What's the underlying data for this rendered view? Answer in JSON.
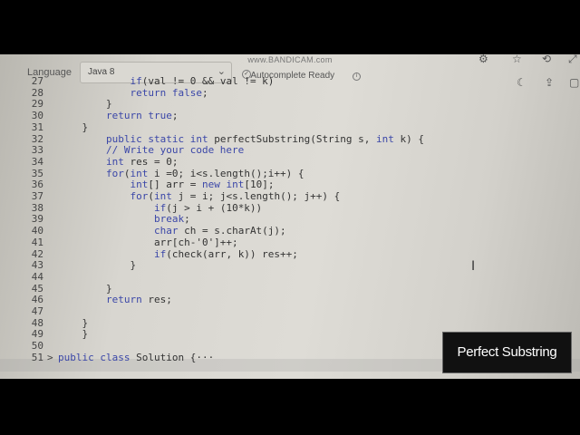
{
  "watermark": "www.BANDICAM.com",
  "toolbar": {
    "language_label": "Language",
    "language_value": "Java 8",
    "autocomplete_label": "Autocomplete Ready",
    "icons": [
      "gear-icon",
      "star-icon",
      "refresh-icon",
      "expand-icon",
      "moon-icon",
      "export-icon",
      "settings-icon"
    ]
  },
  "caption": "Perfect Substring",
  "editor": {
    "lines": [
      {
        "n": "27",
        "text": "            if(val != 0 && val != k)"
      },
      {
        "n": "28",
        "text": "            return false;"
      },
      {
        "n": "29",
        "text": "        }"
      },
      {
        "n": "30",
        "text": "        return true;"
      },
      {
        "n": "31",
        "text": "    }"
      },
      {
        "n": "32",
        "text": "        public static int perfectSubstring(String s, int k) {"
      },
      {
        "n": "33",
        "text": "        // Write your code here"
      },
      {
        "n": "34",
        "text": "        int res = 0;"
      },
      {
        "n": "35",
        "text": "        for(int i =0; i<s.length();i++) {"
      },
      {
        "n": "36",
        "text": "            int[] arr = new int[10];"
      },
      {
        "n": "37",
        "text": "            for(int j = i; j<s.length(); j++) {"
      },
      {
        "n": "38",
        "text": "                if(j > i + (10*k))"
      },
      {
        "n": "39",
        "text": "                break;"
      },
      {
        "n": "40",
        "text": "                char ch = s.charAt(j);"
      },
      {
        "n": "41",
        "text": "                arr[ch-'0']++;"
      },
      {
        "n": "42",
        "text": "                if(check(arr, k)) res++;"
      },
      {
        "n": "43",
        "text": "            }"
      },
      {
        "n": "44",
        "text": ""
      },
      {
        "n": "45",
        "text": "        }"
      },
      {
        "n": "46",
        "text": "        return res;"
      },
      {
        "n": "47",
        "text": ""
      },
      {
        "n": "48",
        "text": "    }"
      },
      {
        "n": "49",
        "text": "    }"
      },
      {
        "n": "50",
        "text": ""
      },
      {
        "n": "51",
        "text": "public class Solution {···"
      }
    ]
  }
}
